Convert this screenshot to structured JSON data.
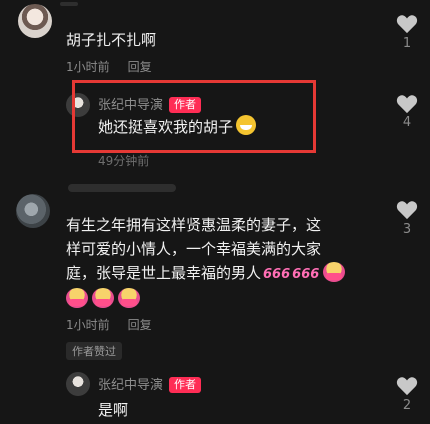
{
  "comments": [
    {
      "text": "胡子扎不扎啊",
      "time": "1小时前",
      "reply_label": "回复",
      "likes": "1"
    },
    {
      "author": "张纪中导演",
      "author_tag": "作者",
      "text": "她还挺喜欢我的胡子",
      "time": "49分钟前",
      "likes": "4",
      "highlight_color": "#e53935"
    },
    {
      "text_lines": [
        "有生之年拥有这样贤惠温柔的妻子，这",
        "样可爱的小情人，一个幸福美满的大家",
        "庭，张导是世上最幸福的男人"
      ],
      "emoji_inline": [
        "666",
        "666"
      ],
      "time": "1小时前",
      "reply_label": "回复",
      "liked_by_author": "作者赞过",
      "likes": "3"
    },
    {
      "author": "张纪中导演",
      "author_tag": "作者",
      "text": "是啊",
      "likes": "2"
    }
  ],
  "icons": {
    "like": "heart-icon",
    "emoji_grin": "grinning-face-icon",
    "emoji_cheer": "cheering-emoji-icon"
  },
  "colors": {
    "background": "#161616",
    "author_tag": "#ff2d55",
    "heart": "#c8c8c8"
  }
}
